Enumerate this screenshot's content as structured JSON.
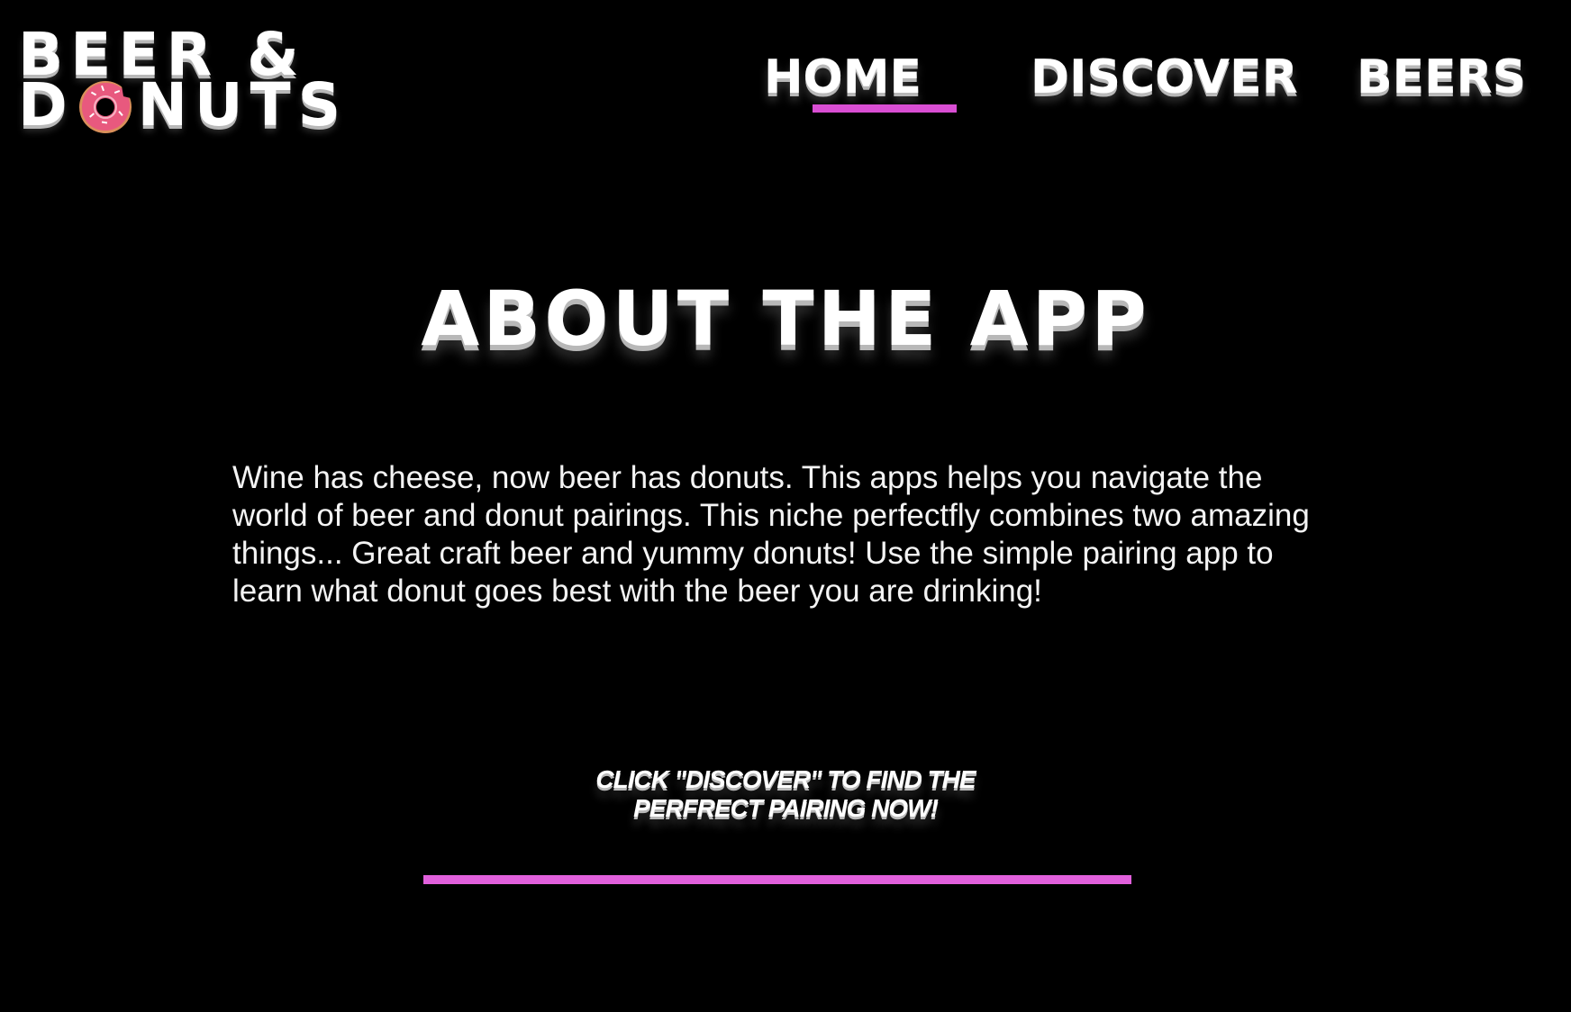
{
  "logo": {
    "line1": "BEER &",
    "line2_first": "D",
    "line2_rest": "NUTS",
    "donut_icon": "pink-frosted-donut-icon"
  },
  "nav": {
    "items": [
      {
        "label": "HOME",
        "active": true
      },
      {
        "label": "DISCOVER",
        "active": false
      },
      {
        "label": "BEERS",
        "active": false
      }
    ]
  },
  "main": {
    "title": "ABOUT THE APP",
    "body": "Wine has cheese, now beer has donuts. This apps helps you navigate the world of beer and donut pairings. This niche perfectfly combines two amazing things... Great craft beer and yummy donuts! Use the simple pairing app to learn what donut goes best with the beer you are drinking!",
    "cta": "CLICK \"DISCOVER\" TO FIND THE PERFRECT PAIRING NOW!"
  },
  "colors": {
    "background": "#000000",
    "text": "#ffffff",
    "accent": "#d94ed3",
    "donut_frosting": "#e8597e"
  }
}
